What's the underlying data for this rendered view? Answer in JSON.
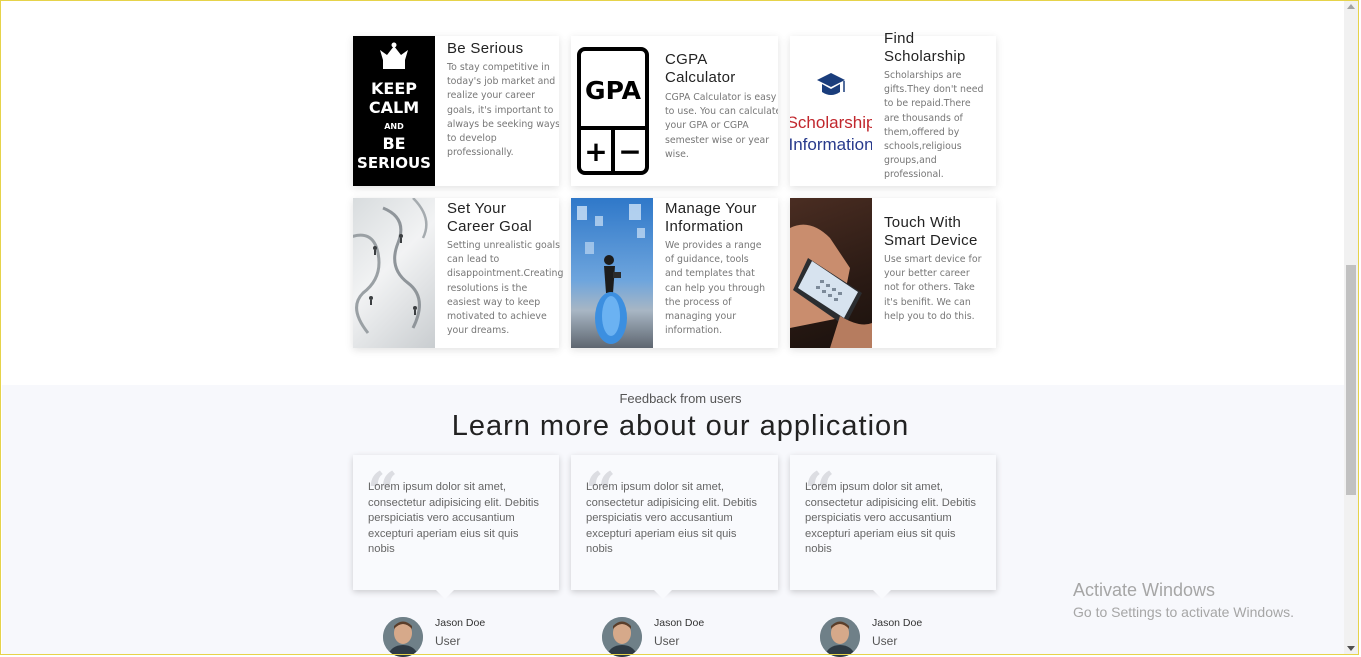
{
  "features": [
    {
      "title": "Be Serious",
      "desc": "To stay competitive in today's job market and realize your career goals, it's important to always be seeking ways to develop professionally.",
      "image": "keep-calm-image",
      "image_text": [
        "KEEP",
        "CALM",
        "AND",
        "BE",
        "SERIOUS"
      ]
    },
    {
      "title": "CGPA Calculator",
      "desc": "CGPA Calculator is easy to use. You can calculate your GPA or CGPA semester wise or year wise.",
      "image": "gpa-calculator-icon",
      "image_text": [
        "GPA",
        "+",
        "−"
      ]
    },
    {
      "title": "Find Scholarship",
      "desc": "Scholarships are gifts.They don't need to be repaid.There are thousands of them,offered by schools,religious groups,and professional.",
      "image": "scholarship-logo",
      "image_text": [
        "Scholarship",
        "Information"
      ]
    },
    {
      "title": "Set Your Career Goal",
      "desc": "Setting unrealistic goals can lead to disappointment.Creating resolutions is the easiest way to keep motivated to achieve your dreams.",
      "image": "career-goal-photo"
    },
    {
      "title": "Manage Your Information",
      "desc": "We provides a range of guidance, tools and templates that can help you through the process of managing your information.",
      "image": "manage-information-photo"
    },
    {
      "title": "Touch With Smart Device",
      "desc": "Use smart device for your better career not for others. Take it's benifit. We can help you to do this.",
      "image": "smart-device-photo"
    }
  ],
  "feedback": {
    "eyebrow": "Feedback from users",
    "headline": "Learn more about our application",
    "testimonials": [
      {
        "quote": "Lorem ipsum dolor sit amet, consectetur adipisicing elit. Debitis perspiciatis vero accusantium excepturi aperiam eius sit quis nobis",
        "name": "Jason Doe",
        "role": "User"
      },
      {
        "quote": "Lorem ipsum dolor sit amet, consectetur adipisicing elit. Debitis perspiciatis vero accusantium excepturi aperiam eius sit quis nobis",
        "name": "Jason Doe",
        "role": "User"
      },
      {
        "quote": "Lorem ipsum dolor sit amet, consectetur adipisicing elit. Debitis perspiciatis vero accusantium excepturi aperiam eius sit quis nobis",
        "name": "Jason Doe",
        "role": "User"
      }
    ]
  },
  "watermark": {
    "line1": "Activate Windows",
    "line2": "Go to Settings to activate Windows."
  },
  "colors": {
    "page_bg": "#ffffff",
    "section_bg": "#f7f8fc",
    "scholarship_red": "#c1272d",
    "scholarship_blue": "#283a8c",
    "frame_border": "#e6d34a"
  }
}
